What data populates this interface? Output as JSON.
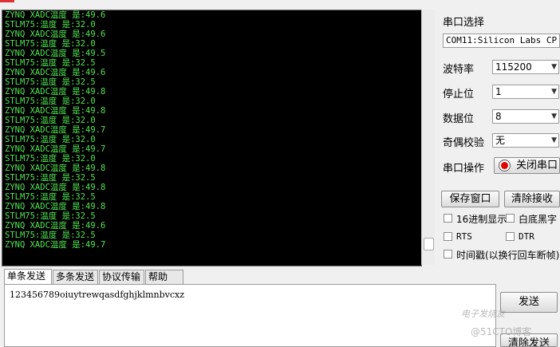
{
  "receive": {
    "lines": [
      "ZYNQ XADC温度 是:49.6",
      "STLM75:温度 是:32.0",
      "ZYNQ XADC温度 是:49.6",
      "STLM75:温度 是:32.0",
      "ZYNQ XADC温度 是:49.5",
      "STLM75:温度 是:32.5",
      "ZYNQ XADC温度 是:49.6",
      "STLM75:温度 是:32.5",
      "ZYNQ XADC温度 是:49.8",
      "STLM75:温度 是:32.0",
      "ZYNQ XADC温度 是:49.8",
      "STLM75:温度 是:32.0",
      "ZYNQ XADC温度 是:49.7",
      "STLM75:温度 是:32.0",
      "ZYNQ XADC温度 是:49.7",
      "STLM75:温度 是:32.0",
      "ZYNQ XADC温度 是:49.8",
      "STLM75:温度 是:32.5",
      "ZYNQ XADC温度 是:49.8",
      "STLM75:温度 是:32.5",
      "ZYNQ XADC温度 是:49.8",
      "STLM75:温度 是:32.5",
      "ZYNQ XADC温度 是:49.6",
      "STLM75:温度 是:32.5",
      "ZYNQ XADC温度 是:49.7"
    ]
  },
  "panel": {
    "port_select_label": "串口选择",
    "port_value": "COM11:Silicon Labs CP",
    "baud_label": "波特率",
    "baud_value": "115200",
    "stopbits_label": "停止位",
    "stopbits_value": "1",
    "databits_label": "数据位",
    "databits_value": "8",
    "parity_label": "奇偶校验",
    "parity_value": "无",
    "port_op_label": "串口操作",
    "close_port_label": "关闭串口",
    "save_window_label": "保存窗口",
    "clear_receive_label": "清除接收",
    "hex_display_label": "16进制显示",
    "white_black_label": "白底黑字",
    "rts_label": "RTS",
    "dtr_label": "DTR",
    "timestamp_label": "时间戳(以换行回车断帧)"
  },
  "tabs": [
    "单条发送",
    "多条发送",
    "协议传输",
    "帮助"
  ],
  "send": {
    "text": "123456789oiuytrewqasdfghjklmnbvcxz",
    "send_label": "发送",
    "clear_send_label": "清除发送"
  },
  "watermark": {
    "line1": "电子发烧友",
    "line2": "@51CTO博客"
  },
  "colors": {
    "terminal_bg": "#000000",
    "terminal_text": "#52e352",
    "indicator_red": "#e00000"
  }
}
